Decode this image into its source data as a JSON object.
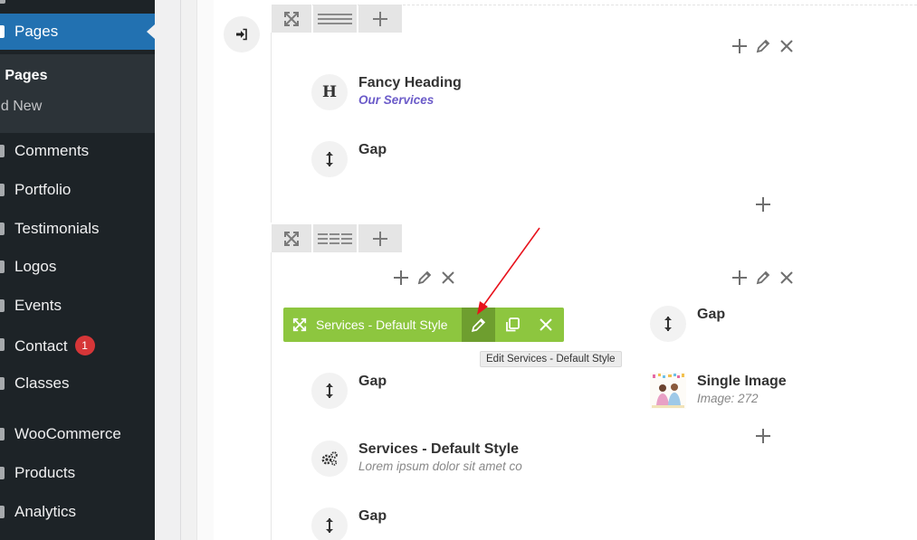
{
  "sidebar": {
    "current_menu": "Pages",
    "submenu": [
      {
        "label": "ll Pages",
        "current": true
      },
      {
        "label": "dd New",
        "current": false
      }
    ],
    "items": [
      {
        "label": "Comments"
      },
      {
        "label": "Portfolio"
      },
      {
        "label": "Testimonials"
      },
      {
        "label": "Logos"
      },
      {
        "label": "Events"
      },
      {
        "label": "Contact",
        "badge": "1"
      },
      {
        "label": "Classes"
      },
      {
        "label": "WooCommerce"
      },
      {
        "label": "Products"
      },
      {
        "label": "Analytics"
      }
    ]
  },
  "builder": {
    "row1": {
      "elements": [
        {
          "title": "Fancy Heading",
          "subtitle": "Our Services",
          "icon": "heading-icon",
          "icon_glyph": "H"
        },
        {
          "title": "Gap",
          "icon": "vertical-arrows-icon"
        }
      ]
    },
    "row2": {
      "left_column": {
        "toolbar": {
          "label": "Services - Default Style",
          "tooltip": "Edit Services - Default Style"
        },
        "elements": [
          {
            "title": "Gap",
            "icon": "vertical-arrows-icon"
          },
          {
            "title": "Services - Default Style",
            "subtitle": "Lorem ipsum dolor sit amet co",
            "icon": "gears-icon"
          },
          {
            "title": "Gap",
            "icon": "vertical-arrows-icon"
          }
        ]
      },
      "right_column": {
        "elements": [
          {
            "title": "Gap",
            "icon": "vertical-arrows-icon"
          },
          {
            "title": "Single Image",
            "subtitle": "Image: 272",
            "icon": "image-thumbnail"
          }
        ]
      }
    }
  },
  "colors": {
    "sidebar_bg": "#1d2327",
    "menu_current": "#2271b1",
    "toolbar_green": "#8dc63f",
    "accent_purple": "#6b5bc9",
    "badge_red": "#d63638",
    "annotation_arrow": "#e8121c"
  }
}
